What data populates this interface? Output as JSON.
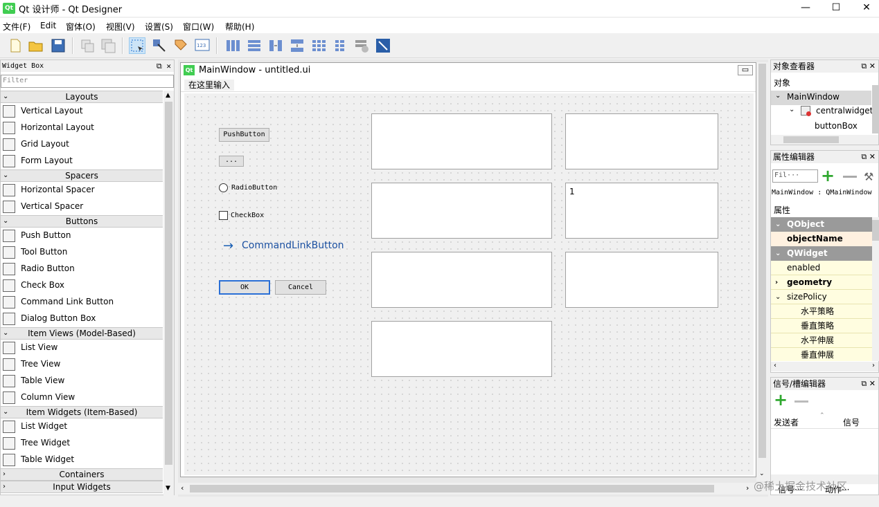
{
  "window": {
    "app_badge": "Qt",
    "title": "Qt 设计师 - Qt Designer",
    "minimize": "—",
    "maximize": "☐",
    "close": "✕"
  },
  "menu": [
    "文件(F)",
    "Edit",
    "窗体(O)",
    "视图(V)",
    "设置(S)",
    "窗口(W)",
    "帮助(H)"
  ],
  "widget_box": {
    "title": "Widget Box",
    "filter_placeholder": "Filter",
    "categories": [
      {
        "label": "Layouts",
        "items": [
          "Vertical Layout",
          "Horizontal Layout",
          "Grid Layout",
          "Form Layout"
        ]
      },
      {
        "label": "Spacers",
        "items": [
          "Horizontal Spacer",
          "Vertical Spacer"
        ]
      },
      {
        "label": "Buttons",
        "items": [
          "Push Button",
          "Tool Button",
          "Radio Button",
          "Check Box",
          "Command Link Button",
          "Dialog Button Box"
        ]
      },
      {
        "label": "Item Views (Model-Based)",
        "items": [
          "List View",
          "Tree View",
          "Table View",
          "Column View"
        ]
      },
      {
        "label": "Item Widgets (Item-Based)",
        "items": [
          "List Widget",
          "Tree Widget",
          "Table Widget"
        ]
      },
      {
        "label": "Containers",
        "items": []
      },
      {
        "label": "Input Widgets",
        "items": []
      }
    ]
  },
  "form": {
    "badge": "Qt",
    "title": "MainWindow - untitled.ui",
    "menubar_placeholder": "在这里输入",
    "push_button": "PushButton",
    "tool_button": "...",
    "radio_button": "RadioButton",
    "check_box": "CheckBox",
    "command_link": "CommandLinkButton",
    "ok": "OK",
    "cancel": "Cancel",
    "text_value": "1"
  },
  "object_inspector": {
    "title": "对象查看器",
    "header": "对象",
    "tree": [
      "MainWindow",
      "centralwidget",
      "buttonBox"
    ]
  },
  "property_editor": {
    "title": "属性编辑器",
    "filter_placeholder": "Fil···",
    "class_line": "MainWindow : QMainWindow",
    "header": "属性",
    "rows": [
      {
        "label": "QObject",
        "kind": "section"
      },
      {
        "label": "objectName",
        "kind": "bold"
      },
      {
        "label": "QWidget",
        "kind": "section"
      },
      {
        "label": "enabled",
        "kind": "yellow"
      },
      {
        "label": "geometry",
        "kind": "boldyellow"
      },
      {
        "label": "sizePolicy",
        "kind": "yellow"
      },
      {
        "label": "水平策略",
        "kind": "sub"
      },
      {
        "label": "垂直策略",
        "kind": "sub"
      },
      {
        "label": "水平伸展",
        "kind": "sub"
      },
      {
        "label": "垂直伸展",
        "kind": "sub"
      }
    ]
  },
  "signal_slot": {
    "title": "信号/槽编辑器",
    "col_sender": "发送者",
    "col_signal": "信号",
    "tab_signal": "信号···",
    "tab_action": "动作···"
  },
  "watermark": "@稀土掘金技术社区"
}
